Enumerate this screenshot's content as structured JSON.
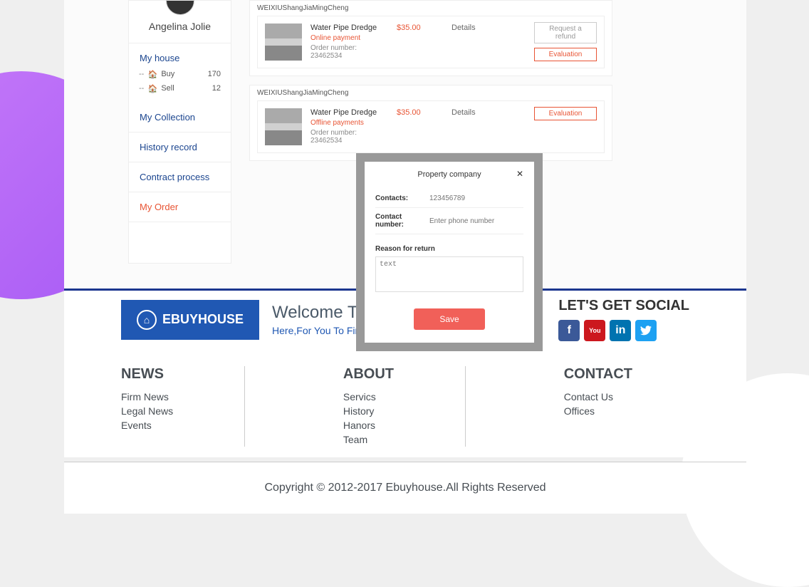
{
  "sidebar": {
    "user_name": "Angelina Jolie",
    "my_house": "My house",
    "buy_label": "Buy",
    "buy_count": "170",
    "sell_label": "Sell",
    "sell_count": "12",
    "my_collection": "My Collection",
    "history_record": "History record",
    "contract_process": "Contract process",
    "my_order": "My Order"
  },
  "orders": [
    {
      "vendor": "WEIXIUShangJiaMingCheng",
      "product": "Water Pipe Dredge",
      "payment": "Online payment",
      "order_label": "Order number: 23462534",
      "price": "$35.00",
      "details": "Details",
      "refund_btn": "Request a refund",
      "eval_btn": "Evaluation"
    },
    {
      "vendor": "WEIXIUShangJiaMingCheng",
      "product": "Water Pipe Dredge",
      "payment": "Offline payments",
      "order_label": "Order number: 23462534",
      "price": "$35.00",
      "details": "Details",
      "eval_btn": "Evaluation"
    }
  ],
  "modal": {
    "title": "Property company",
    "contacts_label": "Contacts:",
    "contacts_placeholder": "123456789",
    "phone_label": "Contact number:",
    "phone_placeholder": "Enter phone number",
    "reason_label": "Reason for return",
    "reason_placeholder": "text",
    "save_btn": "Save"
  },
  "footer": {
    "logo_text": "EBUYHOUSE",
    "welcome_title": "Welcome To",
    "welcome_sub": "Here,For You To Find a Perfect Home!",
    "social_title": "LET'S GET SOCIAL",
    "news": {
      "title": "NEWS",
      "links": [
        "Firm News",
        "Legal News",
        "Events"
      ]
    },
    "about": {
      "title": "ABOUT",
      "links": [
        "Servics",
        "History",
        "Hanors",
        "Team"
      ]
    },
    "contact": {
      "title": "CONTACT",
      "links": [
        "Contact Us",
        "Offices"
      ]
    },
    "copyright": "Copyright  ©  2012-2017 Ebuyhouse.All Rights Reserved"
  }
}
